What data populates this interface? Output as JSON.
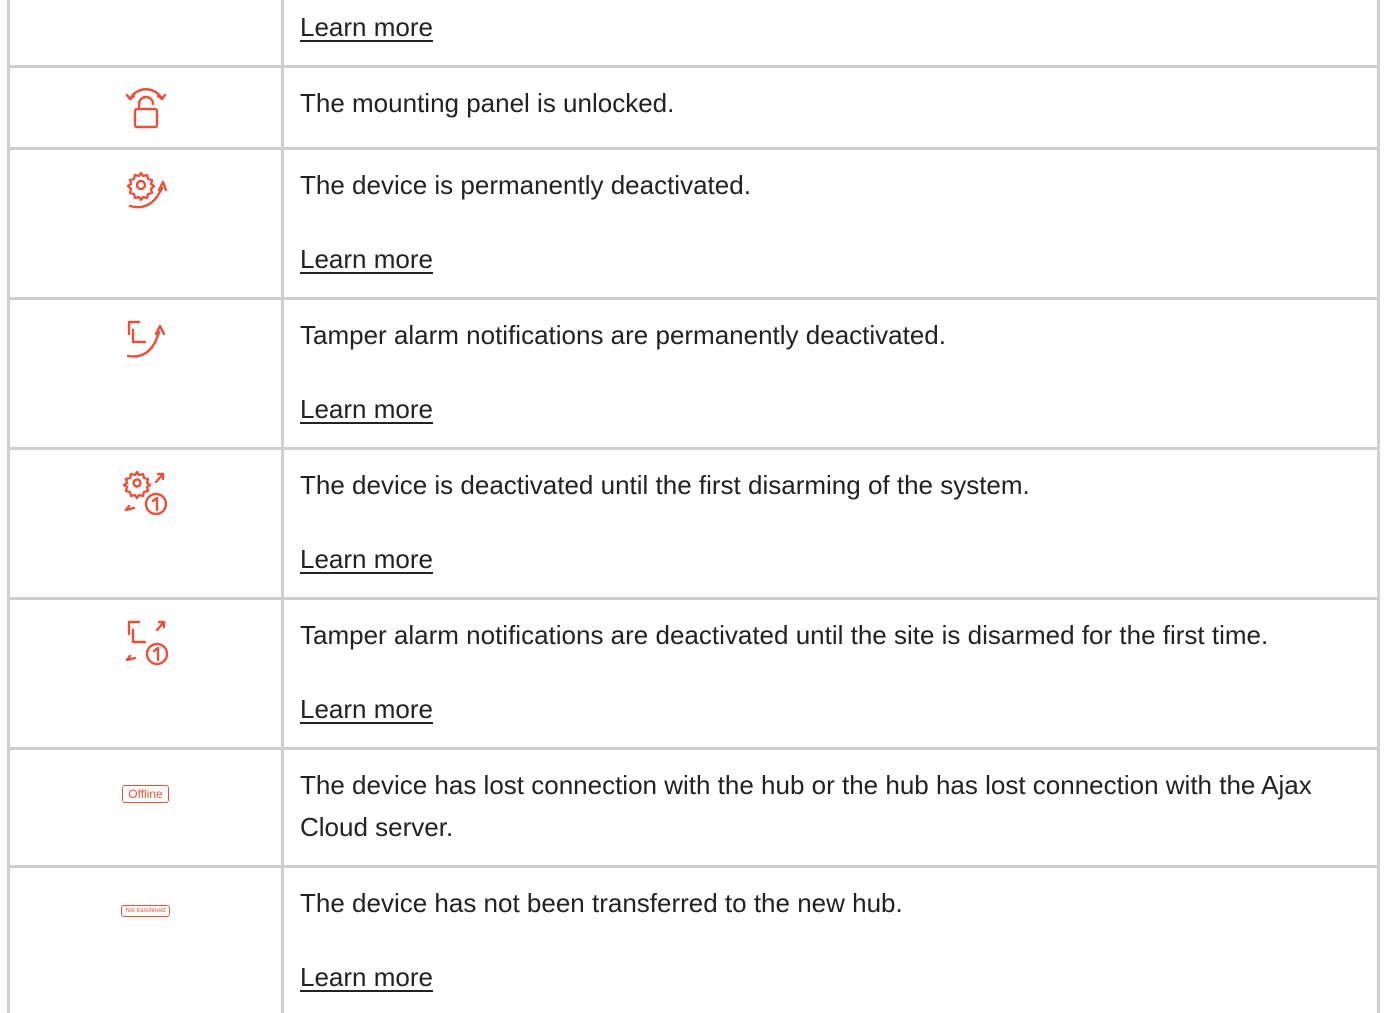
{
  "rows": [
    {
      "icon": "none",
      "description": "",
      "learn_more": "Learn more"
    },
    {
      "icon": "unlocked-panel-icon",
      "description": "The mounting panel is unlocked.",
      "learn_more": ""
    },
    {
      "icon": "gear-deactivated-icon",
      "description": "The device is permanently deactivated.",
      "learn_more": "Learn more"
    },
    {
      "icon": "tamper-deactivated-icon",
      "description": "Tamper alarm notifications are permanently deactivated.",
      "learn_more": "Learn more"
    },
    {
      "icon": "gear-deactivated-once-icon",
      "description": "The device is deactivated until the first disarming of the system.",
      "learn_more": "Learn more"
    },
    {
      "icon": "tamper-deactivated-once-icon",
      "description": "Tamper alarm notifications are deactivated until the site is disarmed for the first time.",
      "learn_more": "Learn more"
    },
    {
      "icon": "offline-badge",
      "badge_text": "Offline",
      "description": "The device has lost connection with the hub or the hub has lost connection with the Ajax Cloud server.",
      "learn_more": ""
    },
    {
      "icon": "not-transferred-badge",
      "badge_text": "Not transferred",
      "description": "The device has not been transferred to the new hub.",
      "learn_more": "Learn more"
    }
  ],
  "colors": {
    "accent": "#e8503a",
    "border": "#cfcfcf",
    "text": "#222222"
  }
}
